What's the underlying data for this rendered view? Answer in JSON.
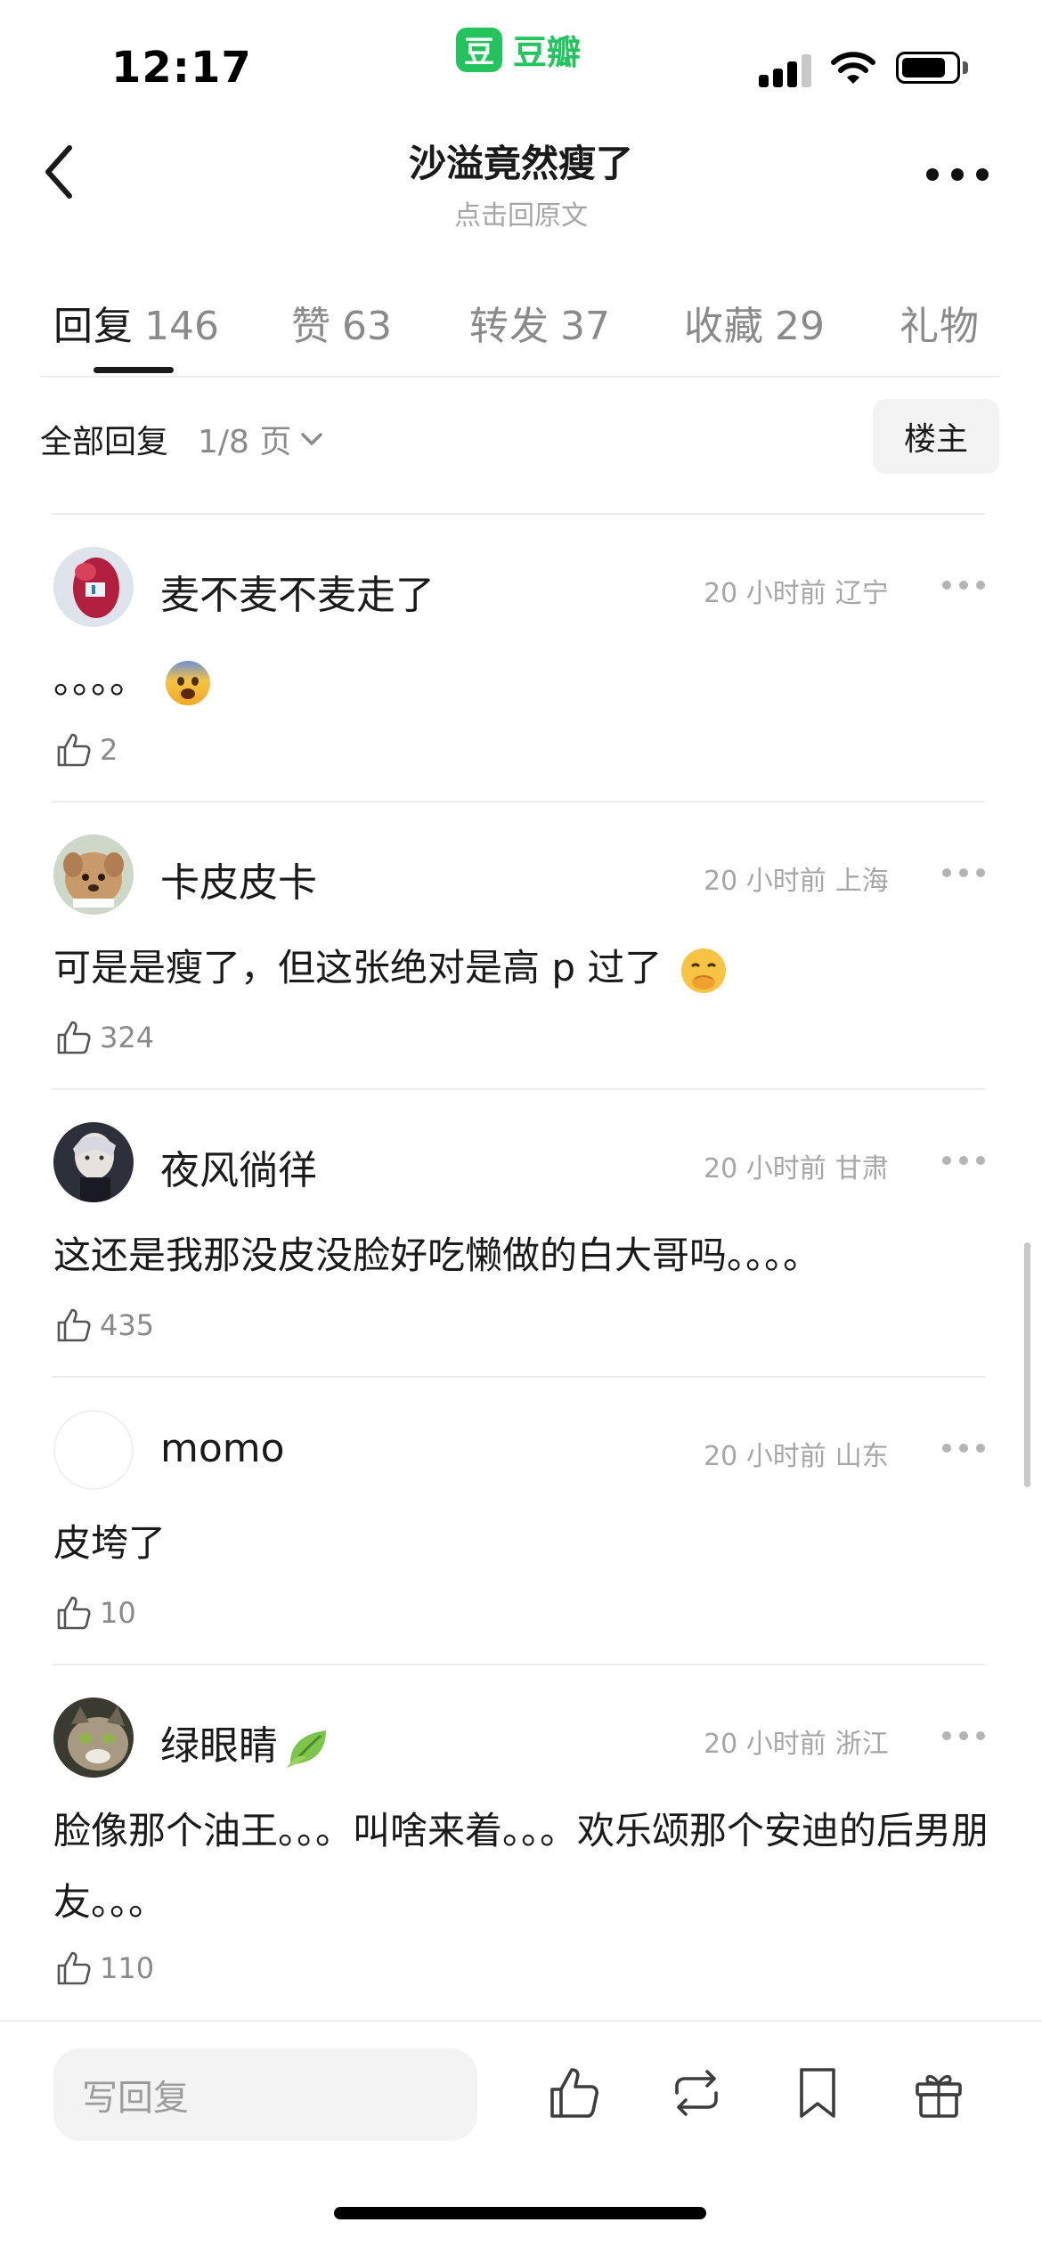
{
  "status_bar": {
    "time": "12:17",
    "battery_percent": 80,
    "signal_bars": 3
  },
  "brand": {
    "logo_char": "豆",
    "name": "豆瓣",
    "color": "#23c45e"
  },
  "header": {
    "title": "沙溢竟然瘦了",
    "subtitle": "点击回原文"
  },
  "tabs": [
    {
      "label": "回复",
      "count": "146",
      "active": true
    },
    {
      "label": "赞",
      "count": "63",
      "active": false
    },
    {
      "label": "转发",
      "count": "37",
      "active": false
    },
    {
      "label": "收藏",
      "count": "29",
      "active": false
    },
    {
      "label": "礼物",
      "count": "",
      "active": false
    }
  ],
  "filter": {
    "label": "全部回复",
    "page": "1/8 页",
    "op_button": "楼主"
  },
  "comments": [
    {
      "username": "麦不麦不麦走了",
      "time": "20 小时前",
      "location": "辽宁",
      "text": "。。。。",
      "emoji": "fearful-face",
      "likes": "2"
    },
    {
      "username": "卡皮皮卡",
      "time": "20 小时前",
      "location": "上海",
      "text": "可是是瘦了，但这张绝对是高 p 过了",
      "emoji": "hand-over-mouth-face",
      "likes": "324"
    },
    {
      "username": "夜风徜徉",
      "time": "20 小时前",
      "location": "甘肃",
      "text": "这还是我那没皮没脸好吃懒做的白大哥吗。。。。",
      "emoji": "",
      "likes": "435"
    },
    {
      "username": "momo",
      "time": "20 小时前",
      "location": "山东",
      "text": "皮垮了",
      "emoji": "",
      "likes": "10"
    },
    {
      "username": "绿眼睛",
      "username_emoji": "leaf",
      "time": "20 小时前",
      "location": "浙江",
      "text": "脸像那个油王。。。叫啥来着。。。欢乐颂那个安迪的后男朋友。。。",
      "emoji": "",
      "likes": "110"
    }
  ],
  "bottom_bar": {
    "reply_placeholder": "写回复"
  }
}
